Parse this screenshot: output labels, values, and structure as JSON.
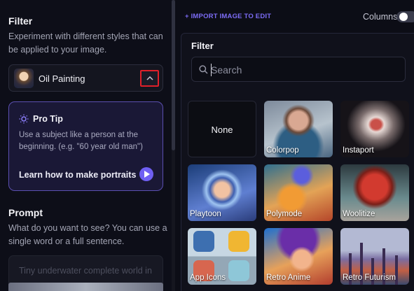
{
  "sidebar": {
    "filter_heading": "Filter",
    "filter_description": "Experiment with different styles that can be applied to your image.",
    "selected_filter": "Oil Painting",
    "pro_tip": {
      "title": "Pro Tip",
      "text": "Use a subject like a person at the beginning. (e.g. \"60 year old man\")",
      "link": "Learn how to make portraits"
    },
    "prompt_heading": "Prompt",
    "prompt_description": "What do you want to see? You can use a single word or a full sentence.",
    "prompt_placeholder": "Tiny underwater complete world in"
  },
  "topbar": {
    "import_label": "+ IMPORT IMAGE TO EDIT",
    "columns_label": "Columns"
  },
  "filter_panel": {
    "title": "Filter",
    "search_placeholder": "Search",
    "items": [
      {
        "label": "None"
      },
      {
        "label": "Colorpop"
      },
      {
        "label": "Instaport"
      },
      {
        "label": "Playtoon"
      },
      {
        "label": "Polymode"
      },
      {
        "label": "Woolitize"
      },
      {
        "label": "App Icons"
      },
      {
        "label": "Retro Anime"
      },
      {
        "label": "Retro Futurism"
      }
    ]
  },
  "colors": {
    "accent": "#7c6cf5",
    "highlight_border": "#e0202a",
    "background": "#0c0d16"
  }
}
